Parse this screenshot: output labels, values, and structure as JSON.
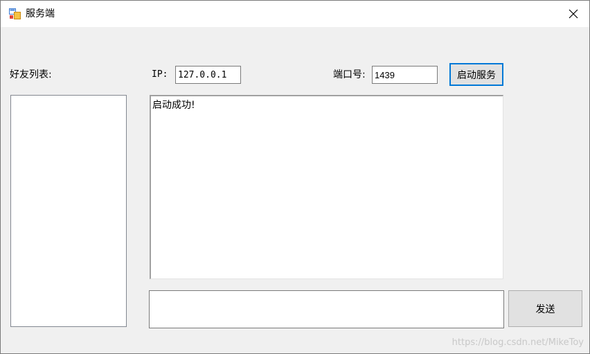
{
  "window": {
    "title": "服务端",
    "app_icon": "winforms-app-icon",
    "close_icon": "close-icon"
  },
  "friends": {
    "label": "好友列表:",
    "items": []
  },
  "connection": {
    "ip_label": "IP:",
    "ip_value": "127.0.0.1",
    "port_label": "端口号:",
    "port_value": "1439",
    "start_button_label": "启动服务"
  },
  "log": {
    "text": "启动成功!"
  },
  "message": {
    "value": "",
    "send_button_label": "发送"
  },
  "watermark": "https://blog.csdn.net/MikeToy",
  "colors": {
    "focus_border": "#0078d7",
    "window_bg": "#f0f0f0",
    "button_bg": "#e1e1e1"
  }
}
